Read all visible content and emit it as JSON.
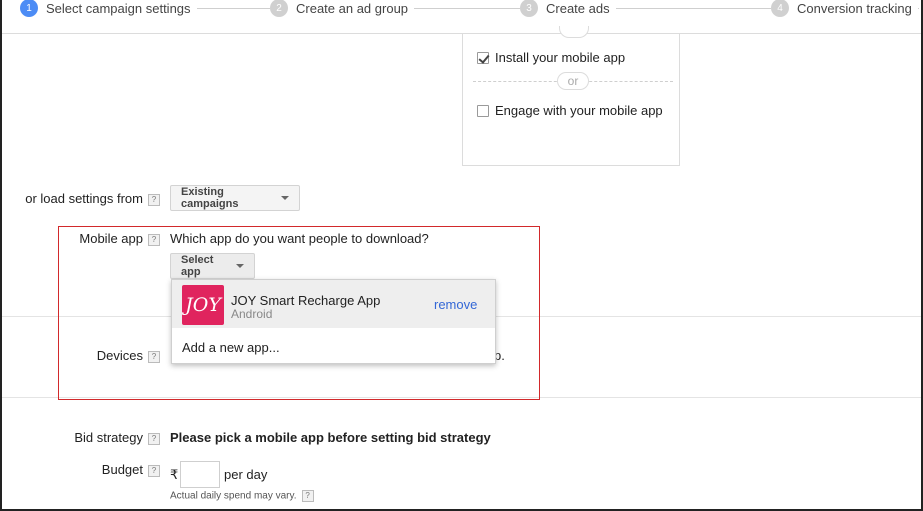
{
  "stepper": {
    "steps": [
      {
        "num": "1",
        "label": "Select campaign settings"
      },
      {
        "num": "2",
        "label": "Create an ad group"
      },
      {
        "num": "3",
        "label": "Create ads"
      },
      {
        "num": "4",
        "label": "Conversion tracking"
      }
    ]
  },
  "goals": {
    "install_label": "Install your mobile app",
    "or_label": "or",
    "engage_label": "Engage with your mobile app"
  },
  "load_settings": {
    "label": "or load settings from",
    "button_label": "Existing campaigns"
  },
  "mobile_app": {
    "label": "Mobile app",
    "question": "Which app do you want people to download?",
    "select_label": "Select app",
    "dropdown": {
      "app_name": "JOY Smart Recharge App",
      "app_platform": "Android",
      "app_icon_text": "JOY",
      "remove_label": "remove",
      "add_label": "Add a new app..."
    }
  },
  "devices": {
    "label": "Devices",
    "trailing_text": "p."
  },
  "bid_strategy": {
    "label": "Bid strategy",
    "message": "Please pick a mobile app before setting bid strategy"
  },
  "budget": {
    "label": "Budget",
    "currency": "₹",
    "value": "",
    "unit": "per day",
    "note": "Actual daily spend may vary."
  },
  "help_glyph": "?",
  "colors": {
    "active_step": "#4c8cf5",
    "highlight_border": "#d2292b",
    "link": "#3367d6",
    "app_icon_bg": "#e0245e"
  }
}
